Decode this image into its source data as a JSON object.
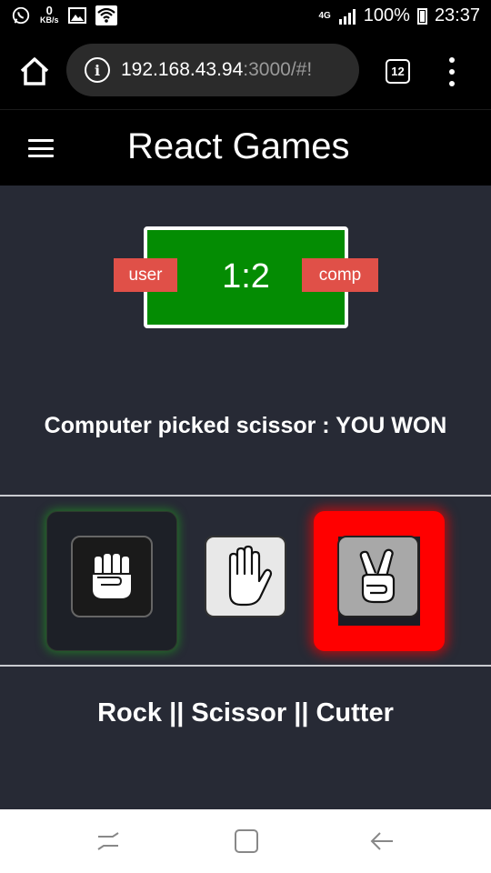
{
  "status_bar": {
    "kb_value": "0",
    "kb_unit": "KB/s",
    "network": "4G",
    "battery": "100%",
    "time": "23:37"
  },
  "browser": {
    "url_host": "192.168.43.94",
    "url_rest": ":3000/#!",
    "tab_count": "12"
  },
  "app": {
    "title": "React Games"
  },
  "scoreboard": {
    "score": "1:2",
    "user_label": "user",
    "comp_label": "comp",
    "color": "#048c03"
  },
  "result_text": "Computer picked scissor : YOU WON",
  "choices": [
    {
      "name": "rock",
      "selected_by": "user",
      "highlight": "#22aa22"
    },
    {
      "name": "paper",
      "selected_by": "",
      "highlight": ""
    },
    {
      "name": "cutter",
      "selected_by": "computer",
      "highlight": "#ff0000"
    }
  ],
  "game_name": "Rock || Scissor || Cutter"
}
